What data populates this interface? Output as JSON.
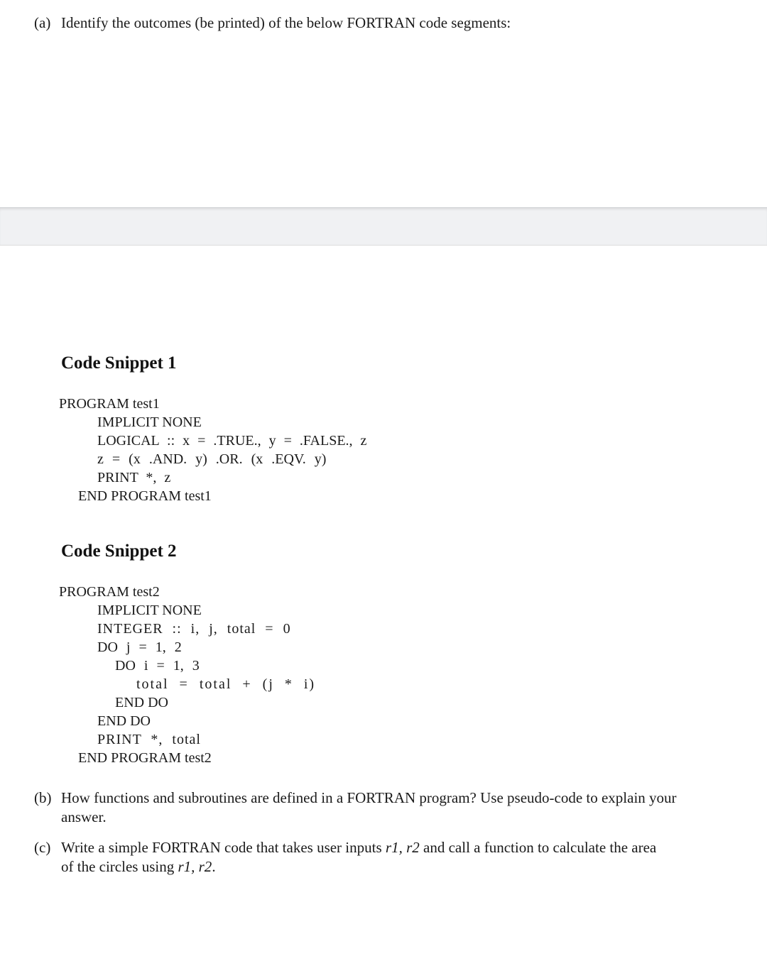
{
  "question_a": {
    "label": "(a)",
    "text": "Identify the outcomes (be printed) of the below FORTRAN code segments:"
  },
  "snippet1": {
    "heading": "Code Snippet 1",
    "lines": [
      "PROGRAM test1",
      "IMPLICIT NONE",
      "LOGICAL :: x = .TRUE., y = .FALSE., z",
      "z = (x .AND. y) .OR. (x .EQV. y)",
      "PRINT *, z",
      "END PROGRAM test1"
    ]
  },
  "snippet2": {
    "heading": "Code Snippet 2",
    "lines": [
      "PROGRAM test2",
      "IMPLICIT NONE",
      "INTEGER :: i, j, total = 0",
      "DO j = 1, 2",
      "DO i = 1, 3",
      "total = total + (j * i)",
      "END DO",
      "END DO",
      "PRINT *, total",
      "END PROGRAM test2"
    ]
  },
  "question_b": {
    "label": "(b)",
    "line1": "How functions and subroutines are defined in a FORTRAN program? Use pseudo-code to explain your",
    "line2": "answer."
  },
  "question_c": {
    "label": "(c)",
    "line1_pre": "Write a simple FORTRAN code that takes user inputs ",
    "line1_math": "r1, r2",
    "line1_post": " and call a function to calculate the area",
    "line2_pre": "of the circles using ",
    "line2_math": "r1, r2",
    "line2_post": "."
  }
}
